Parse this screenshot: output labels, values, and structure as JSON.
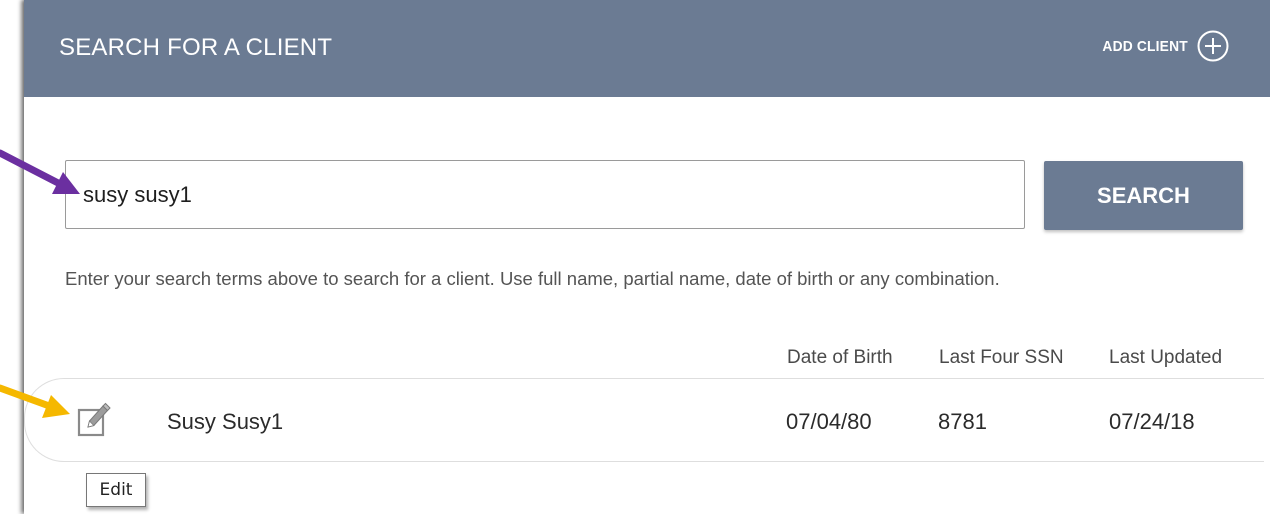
{
  "header": {
    "title": "SEARCH FOR A CLIENT",
    "add_client_label": "ADD CLIENT",
    "background_color": "#6b7b93"
  },
  "search": {
    "value": "susy susy1",
    "button_label": "SEARCH",
    "helper_text": "Enter your search terms above to search for a client. Use full name, partial name, date of birth or any combination."
  },
  "results": {
    "columns": [
      "Date of Birth",
      "Last Four SSN",
      "Last Updated"
    ],
    "rows": [
      {
        "name": "Susy Susy1",
        "dob": "07/04/80",
        "ssn": "8781",
        "updated": "07/24/18"
      }
    ]
  },
  "tooltip": {
    "text": "Edit"
  },
  "annotations": {
    "purple_arrow_color": "#6b2fa0",
    "yellow_arrow_color": "#f5b800"
  },
  "icons": [
    "plus-circle-icon",
    "edit-icon"
  ]
}
